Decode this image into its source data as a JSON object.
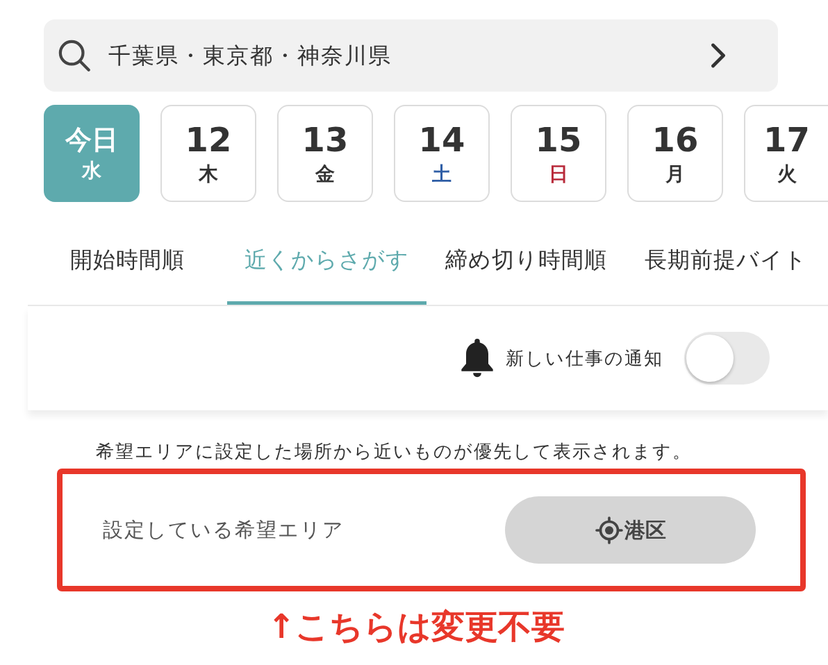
{
  "area_selector": {
    "text": "千葉県・東京都・神奈川県"
  },
  "dates": [
    {
      "day": "今日",
      "weekday": "水",
      "selected": true
    },
    {
      "day": "12",
      "weekday": "木",
      "selected": false,
      "color": "#333333"
    },
    {
      "day": "13",
      "weekday": "金",
      "selected": false,
      "color": "#333333"
    },
    {
      "day": "14",
      "weekday": "土",
      "selected": false,
      "color": "#2f5ea6"
    },
    {
      "day": "15",
      "weekday": "日",
      "selected": false,
      "color": "#b82a3a"
    },
    {
      "day": "16",
      "weekday": "月",
      "selected": false,
      "color": "#333333"
    },
    {
      "day": "17",
      "weekday": "火",
      "selected": false,
      "color": "#333333"
    }
  ],
  "tabs": [
    {
      "label": "開始時間順",
      "selected": false
    },
    {
      "label": "近くからさがす",
      "selected": true
    },
    {
      "label": "締め切り時間順",
      "selected": false
    },
    {
      "label": "長期前提バイト",
      "selected": false
    }
  ],
  "notification": {
    "label": "新しい仕事の通知",
    "on": false
  },
  "notice": "希望エリアに設定した場所から近いものが優先して表示されます。",
  "preferred_area": {
    "label": "設定している希望エリア",
    "value": "港区"
  },
  "annotation": {
    "text": "↑こちらは変更不要"
  }
}
